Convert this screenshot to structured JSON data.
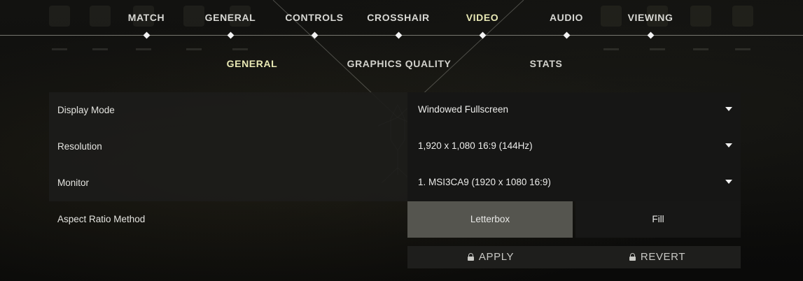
{
  "nav": {
    "tabs": [
      {
        "label": "MATCH"
      },
      {
        "label": "GENERAL"
      },
      {
        "label": "CONTROLS"
      },
      {
        "label": "CROSSHAIR"
      },
      {
        "label": "VIDEO",
        "active": true
      },
      {
        "label": "AUDIO"
      },
      {
        "label": "VIEWING"
      }
    ]
  },
  "subnav": {
    "tabs": [
      {
        "label": "GENERAL",
        "active": true
      },
      {
        "label": "GRAPHICS QUALITY"
      },
      {
        "label": "STATS"
      }
    ]
  },
  "settings": {
    "display_mode": {
      "label": "Display Mode",
      "value": "Windowed Fullscreen"
    },
    "resolution": {
      "label": "Resolution",
      "value": "1,920 x 1,080 16:9 (144Hz)"
    },
    "monitor": {
      "label": "Monitor",
      "value": "1. MSI3CA9 (1920 x  1080 16:9)"
    },
    "aspect_ratio": {
      "label": "Aspect Ratio Method",
      "options": [
        "Letterbox",
        "Fill"
      ],
      "selected": "Letterbox"
    }
  },
  "actions": {
    "apply_label": "APPLY",
    "revert_label": "REVERT"
  },
  "colors": {
    "active_tab": "#e9e9b5",
    "selected_segment": "#55554f",
    "row_background": "#1c1c1a"
  }
}
